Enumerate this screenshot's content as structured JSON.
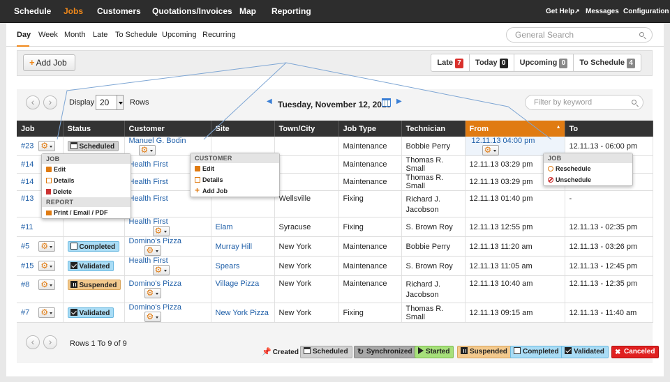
{
  "topnav": {
    "items": [
      "Schedule",
      "Jobs",
      "Customers",
      "Quotations/Invoices",
      "Map",
      "Reporting"
    ],
    "active": "Jobs",
    "right": [
      "Get Help",
      "Messages",
      "Configuration"
    ]
  },
  "subnav": {
    "tabs": [
      "Day",
      "Week",
      "Month",
      "Late",
      "To Schedule",
      "Upcoming",
      "Recurring"
    ],
    "active": "Day",
    "search_placeholder": "General Search"
  },
  "toolbar": {
    "add_job": "Add Job",
    "filters": [
      {
        "label": "Late",
        "count": "7",
        "color": "#d9302c"
      },
      {
        "label": "Today",
        "count": "0",
        "color": "#222222"
      },
      {
        "label": "Upcoming",
        "count": "0",
        "color": "#888888"
      },
      {
        "label": "To Schedule",
        "count": "4",
        "color": "#888888"
      }
    ]
  },
  "listbar": {
    "display_label": "Display",
    "rows_value": "20",
    "rows_label": "Rows",
    "date": "Tuesday, November 12, 2013",
    "keyword_placeholder": "Filter by keyword"
  },
  "table": {
    "headers": [
      "Job",
      "Status",
      "Customer",
      "Site",
      "Town/City",
      "Job Type",
      "Technician",
      "From",
      "To"
    ],
    "sorted_column": "From",
    "rows": [
      {
        "job": "#23",
        "status": "Scheduled",
        "customer": "Manuel G. Bodin",
        "site": "",
        "town": "",
        "type": "Maintenance",
        "tech": "Bobbie Perry",
        "from": "12.11.13 04:00 pm",
        "to": "12.11.13 - 06:00 pm"
      },
      {
        "job": "#14",
        "status": "",
        "customer": "Health First",
        "site": "",
        "town": "",
        "type": "Maintenance",
        "tech": "Thomas R. Small",
        "from": "12.11.13 03:29 pm",
        "to": ""
      },
      {
        "job": "#14",
        "status": "",
        "customer": "Health First",
        "site": "",
        "town": "",
        "type": "Maintenance",
        "tech": "Thomas R. Small",
        "from": "12.11.13 03:29 pm",
        "to": ""
      },
      {
        "job": "#13",
        "status": "",
        "customer": "Health First",
        "site": "",
        "town": "Wellsville",
        "type": "Fixing",
        "tech": "Richard J. Jacobson",
        "from": "12.11.13 01:40 pm",
        "to": "-"
      },
      {
        "job": "#11",
        "status": "",
        "customer": "Health First",
        "site": "Elam",
        "town": "Syracuse",
        "type": "Fixing",
        "tech": "S. Brown Roy",
        "from": "12.11.13 12:55 pm",
        "to": "12.11.13 - 02:35 pm"
      },
      {
        "job": "#5",
        "status": "Completed",
        "customer": "Domino's Pizza",
        "site": "Murray Hill",
        "town": "New York",
        "type": "Maintenance",
        "tech": "Bobbie Perry",
        "from": "12.11.13 11:20 am",
        "to": "12.11.13 - 03:26 pm"
      },
      {
        "job": "#15",
        "status": "Validated",
        "customer": "Health First",
        "site": "Spears",
        "town": "New York",
        "type": "Maintenance",
        "tech": "S. Brown Roy",
        "from": "12.11.13 11:05 am",
        "to": "12.11.13 - 12:45 pm"
      },
      {
        "job": "#8",
        "status": "Suspended",
        "customer": "Domino's Pizza",
        "site": "Village Pizza",
        "town": "New York",
        "type": "Maintenance",
        "tech": "Richard J. Jacobson",
        "from": "12.11.13 10:40 am",
        "to": "12.11.13 - 12:35 pm"
      },
      {
        "job": "#7",
        "status": "Validated",
        "customer": "Domino's Pizza",
        "site": "New York Pizza",
        "town": "New York",
        "type": "Fixing",
        "tech": "Thomas R. Small",
        "from": "12.11.13 09:15 am",
        "to": "12.11.13 - 11:40 am"
      }
    ]
  },
  "job_menu": {
    "head1": "JOB",
    "items1": [
      "Edit",
      "Details",
      "Delete"
    ],
    "head2": "REPORT",
    "items2": [
      "Print / Email / PDF"
    ]
  },
  "customer_menu": {
    "head": "CUSTOMER",
    "items": [
      "Edit",
      "Details",
      "Add Job"
    ]
  },
  "from_menu": {
    "head": "JOB",
    "items": [
      "Reschedule",
      "Unschedule"
    ]
  },
  "pager": {
    "text": "Rows 1 To 9 of 9"
  },
  "legend": [
    {
      "label": "Created",
      "bg": "transparent",
      "border": "transparent",
      "icon": "pin"
    },
    {
      "label": "Scheduled",
      "bg": "#d0d0d0",
      "border": "#a8a8a8",
      "icon": "cal"
    },
    {
      "label": "Synchronized",
      "bg": "#a8a8a8",
      "border": "#888888",
      "icon": "sync"
    },
    {
      "label": "Started",
      "bg": "#a6e07a",
      "border": "#7cbc4f",
      "icon": "play"
    },
    {
      "label": "Suspended",
      "bg": "#f3c98d",
      "border": "#d9a55c",
      "icon": "pause"
    },
    {
      "label": "Completed",
      "bg": "#a9dcf5",
      "border": "#6cb9e0",
      "icon": "box"
    },
    {
      "label": "Validated",
      "bg": "#a9dcf5",
      "border": "#6cb9e0",
      "icon": "check"
    },
    {
      "label": "Canceled",
      "bg": "#e02020",
      "border": "#b01010",
      "icon": "cancel"
    }
  ],
  "colors": {
    "accent": "#f0881a",
    "link": "#1f5fa8",
    "header": "#333333",
    "sorted": "#e07b12"
  }
}
